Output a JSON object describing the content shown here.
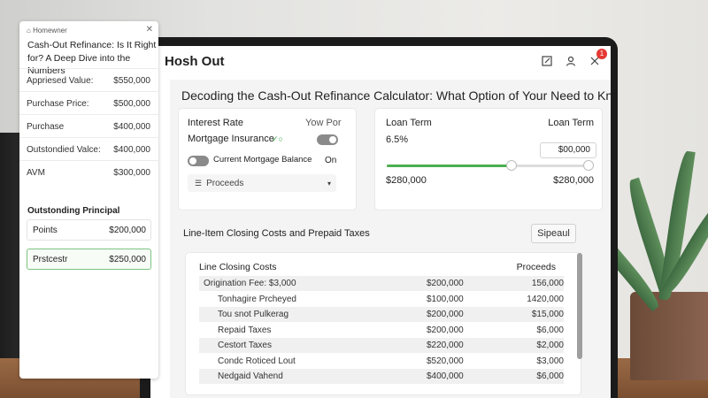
{
  "app": {
    "title": "Hosh Out",
    "notification_count": "1",
    "headline": "Decoding the Cash-Out Refinance Calculator: What Option of Your Need to Know"
  },
  "left_card": {
    "interest_rate_label": "Interest Rate",
    "yow_por_label": "Yow Por",
    "mortgage_insurance_label": "Mortgage Insurance",
    "mortgage_insurance_badge": "✓○",
    "current_balance_label": "Current Mortgage Balance",
    "current_balance_state": "On",
    "proceeds_select": "Proceeds"
  },
  "right_card": {
    "loan_term_label": "Loan Term",
    "loan_term_label_right": "Loan Term",
    "rate_value": "6.5%",
    "input_value": "$00,000",
    "slider_min": "$280,000",
    "slider_max": "$280,000",
    "slider_fraction": 0.62
  },
  "closing_section": {
    "title": "Line-Item Closing Costs and Prepaid Taxes",
    "button_label": "Sipeaul",
    "col_left": "Line Closing Costs",
    "col_right": "Proceeds",
    "rows": [
      {
        "name": "Origination Fee: $3,000",
        "amount": "$200,000",
        "proceeds": "156,000"
      },
      {
        "name": "Tonhagire Prcheyed",
        "amount": "$100,000",
        "proceeds": "1420,000"
      },
      {
        "name": "Tou snot Pulkerag",
        "amount": "$200,000",
        "proceeds": "$15,000"
      },
      {
        "name": "Repaid Taxes",
        "amount": "$200,000",
        "proceeds": "$6,000"
      },
      {
        "name": "Cestort Taxes",
        "amount": "$220,000",
        "proceeds": "$2,000"
      },
      {
        "name": "Condc Roticed Lout",
        "amount": "$520,000",
        "proceeds": "$3,000"
      },
      {
        "name": "Nedgaid Vahend",
        "amount": "$400,000",
        "proceeds": "$6,000"
      }
    ]
  },
  "panel": {
    "header": "Homewner",
    "title": "Cash-Out Refinance: Is It Right for? A Deep Dive into the Numbers",
    "rows": [
      {
        "label": "Appriesed Value:",
        "value": "$550,000"
      },
      {
        "label": "Purchase Price:",
        "value": "$500,000"
      },
      {
        "label": "Purchase",
        "value": "$400,000"
      },
      {
        "label": "Outstondied Valce:",
        "value": "$400,000"
      },
      {
        "label": "AVM",
        "value": "$300,000"
      }
    ],
    "section_label": "Outstonding Principal",
    "points": {
      "label": "Points",
      "value": "$200,000"
    },
    "selected": {
      "label": "Prstcestr",
      "value": "$250,000"
    }
  },
  "colors": {
    "accent": "#4caf50",
    "badge": "#e53935"
  }
}
